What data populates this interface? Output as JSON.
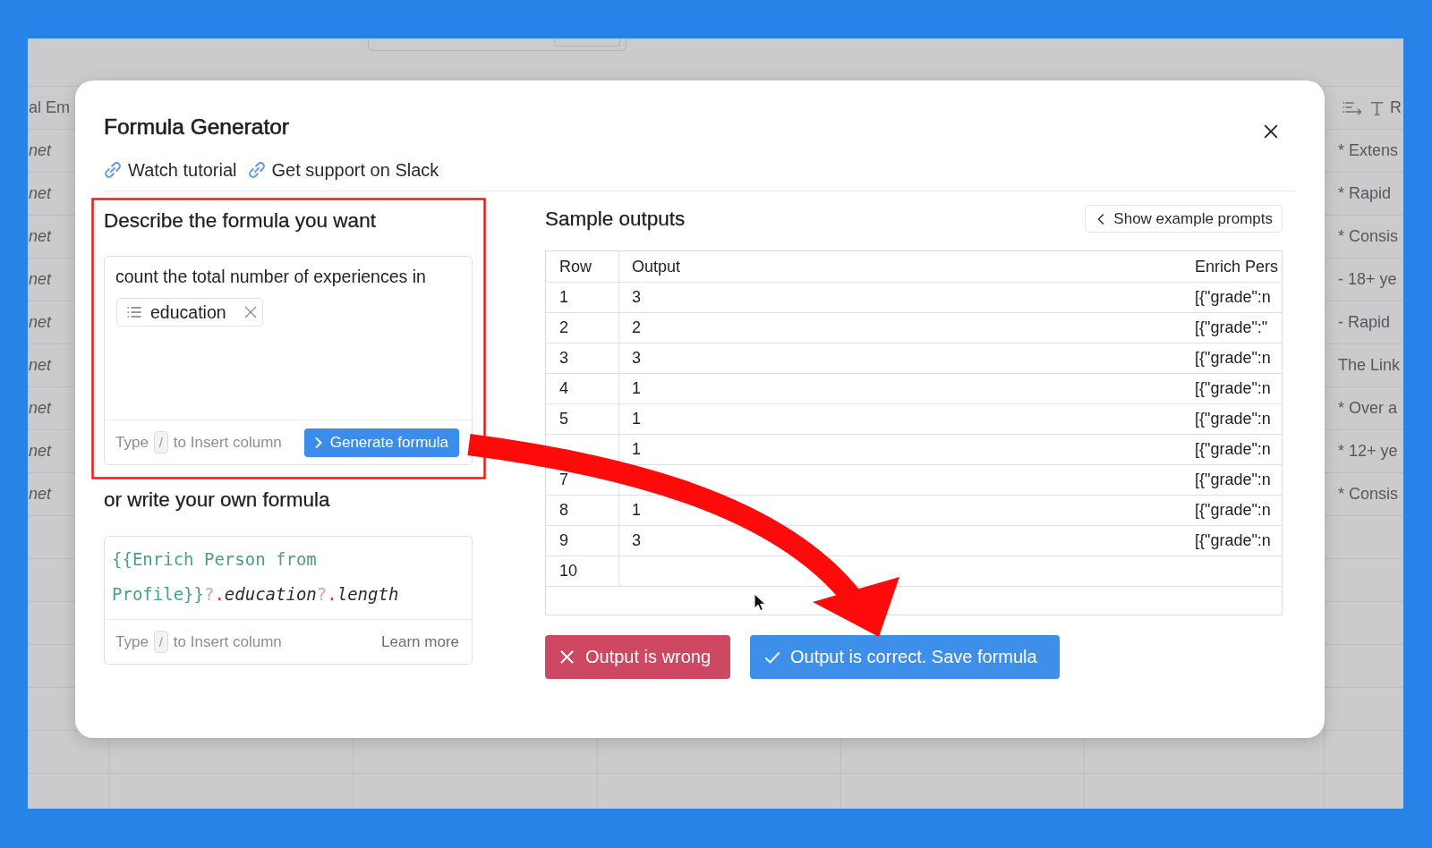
{
  "sheet": {
    "left_column": {
      "header": "al Em",
      "cells": [
        "net",
        "net",
        "net",
        "net",
        "net",
        "net",
        "net",
        "net",
        "net"
      ]
    },
    "right_column": {
      "header": "R",
      "cells": [
        "* Extens",
        "* Rapid",
        "* Consis",
        "- 18+ ye",
        "- Rapid",
        "The Link",
        "* Over a",
        "* 12+ ye",
        "* Consis"
      ]
    }
  },
  "dialog": {
    "title": "Formula Generator",
    "links": [
      {
        "label": "Watch tutorial"
      },
      {
        "label": "Get support on Slack"
      }
    ],
    "describe": {
      "heading": "Describe the formula you want",
      "prompt": {
        "text": "count the total number of experiences in",
        "chips": [
          {
            "label": "education"
          }
        ]
      },
      "hint": {
        "before": "Type",
        "key": "/",
        "after": "to Insert column"
      },
      "button": "Generate formula"
    },
    "own_formula": {
      "heading": "or write your own formula",
      "code": [
        {
          "text": "{{Enrich Person from Profile}}",
          "kind": "ref"
        },
        {
          "text": "?",
          "kind": "question"
        },
        {
          "text": ".",
          "kind": "dot"
        },
        {
          "text": "education",
          "kind": "prop"
        },
        {
          "text": "?",
          "kind": "question"
        },
        {
          "text": ".",
          "kind": "dot"
        },
        {
          "text": "length",
          "kind": "prop"
        }
      ],
      "hint": {
        "before": "Type",
        "key": "/",
        "after": "to Insert column"
      },
      "link": "Learn more"
    },
    "sample_outputs": {
      "heading": "Sample outputs",
      "button": "Show example prompts",
      "table": {
        "columns": [
          "Row",
          "Output",
          "Enrich Pers"
        ],
        "rows": [
          {
            "row": "1",
            "output": "3",
            "column_3": "[{\"grade\":n"
          },
          {
            "row": "2",
            "output": "2",
            "column_3": "[{\"grade\":\""
          },
          {
            "row": "3",
            "output": "3",
            "column_3": "[{\"grade\":n"
          },
          {
            "row": "4",
            "output": "1",
            "column_3": "[{\"grade\":n"
          },
          {
            "row": "5",
            "output": "1",
            "column_3": "[{\"grade\":n"
          },
          {
            "output": "1",
            "column_3": "[{\"grade\":n"
          },
          {
            "row": "7",
            "column_3": "[{\"grade\":n"
          },
          {
            "row": "8",
            "output": "1",
            "column_3": "[{\"grade\":n"
          },
          {
            "row": "9",
            "output": "3",
            "column_3": "[{\"grade\":n"
          },
          {
            "row": "10"
          }
        ]
      }
    },
    "actions": [
      {
        "label": "Output is wrong",
        "kind": "reject"
      },
      {
        "label": "Output is correct. Save formula",
        "kind": "accept"
      }
    ]
  }
}
